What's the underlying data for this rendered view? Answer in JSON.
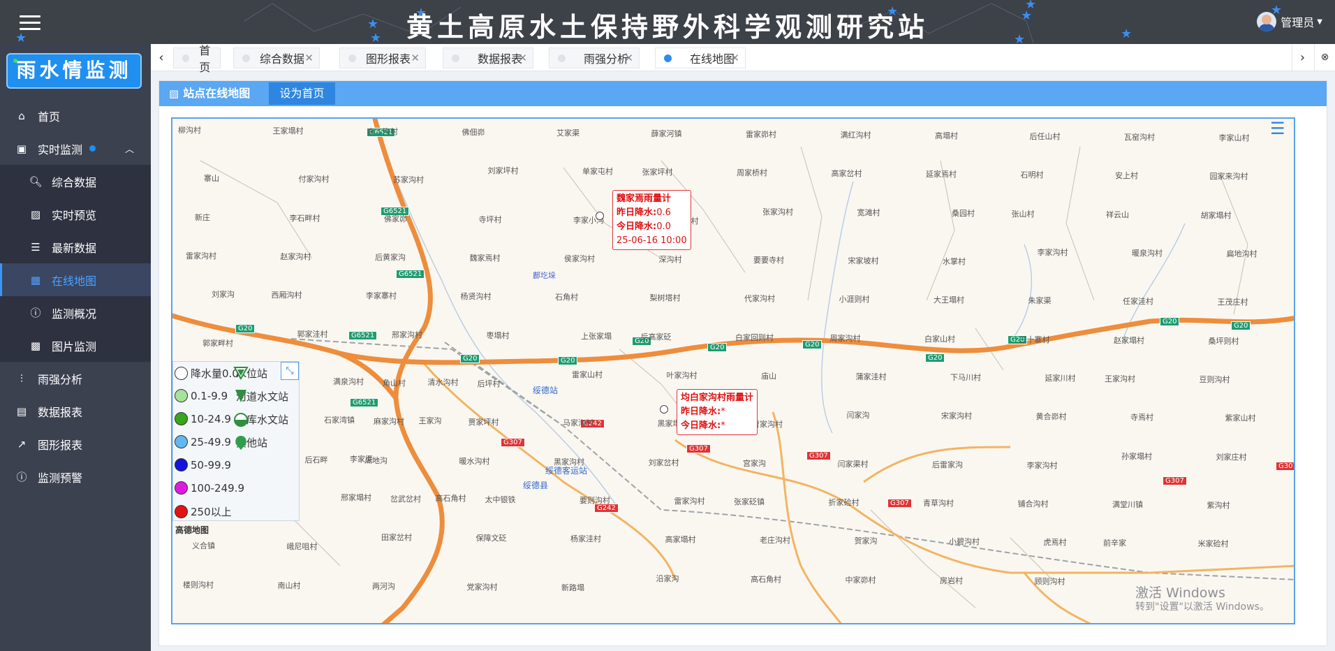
{
  "header": {
    "title": "黄土高原水土保持野外科学观测研究站",
    "user": "管理员"
  },
  "sidebar": {
    "logo": "雨水情监测",
    "items": [
      {
        "label": "首页",
        "icon": "home-icon"
      },
      {
        "label": "实时监测",
        "icon": "monitor-icon"
      },
      {
        "label": "综合数据",
        "icon": "search-doc-icon"
      },
      {
        "label": "实时预览",
        "icon": "image-icon"
      },
      {
        "label": "最新数据",
        "icon": "list-icon"
      },
      {
        "label": "在线地图",
        "icon": "map-icon"
      },
      {
        "label": "监测概况",
        "icon": "info-icon"
      },
      {
        "label": "图片监测",
        "icon": "picture-icon"
      },
      {
        "label": "雨强分析",
        "icon": "analysis-icon"
      },
      {
        "label": "数据报表",
        "icon": "report-icon"
      },
      {
        "label": "图形报表",
        "icon": "chart-icon"
      },
      {
        "label": "监测预警",
        "icon": "warning-icon"
      }
    ]
  },
  "tabs": [
    "首页",
    "综合数据",
    "图形报表",
    "数据报表",
    "雨强分析",
    "在线地图"
  ],
  "panel": {
    "title": "站点在线地图",
    "set_home": "设为首页"
  },
  "popups": [
    {
      "name": "魏家焉雨量计",
      "y_label": "昨日降水:",
      "y_val": "0.6",
      "t_label": "今日降水:",
      "t_val": "0.0",
      "time": "25-06-16 10:00"
    },
    {
      "name": "均白家沟村雨量计",
      "y_label": "昨日降水:",
      "y_val": "*",
      "t_label": "今日降水:",
      "t_val": "*"
    }
  ],
  "legend": {
    "rain": [
      {
        "label": "降水量0.0",
        "color": "#ffffff"
      },
      {
        "label": "0.1-9.9",
        "color": "#a6e39a"
      },
      {
        "label": "10-24.9",
        "color": "#38a51b"
      },
      {
        "label": "25-49.9",
        "color": "#5fb8ef"
      },
      {
        "label": "50-99.9",
        "color": "#1414dc"
      },
      {
        "label": "100-249.9",
        "color": "#e01be0"
      },
      {
        "label": "250以上",
        "color": "#e51212"
      }
    ],
    "stations": [
      "水位站",
      "河道水文站",
      "水库水文站",
      "其他站"
    ]
  },
  "map": {
    "provider": "高德地图",
    "places": [
      "柳沟村",
      "王家塌村",
      "高二沟村",
      "佛佃峁",
      "艾家渠",
      "薛家河镇",
      "雷家峁村",
      "满红沟村",
      "高塌村",
      "后任山村",
      "瓦窑沟村",
      "李家山村",
      "寨山",
      "付家沟村",
      "苏家沟村",
      "刘家坪村",
      "单家屯村",
      "张家坪村",
      "周家桥村",
      "高家岔村",
      "延家焉村",
      "石明村",
      "安上村",
      "园家来沟村",
      "新庄",
      "李石畔村",
      "佛家峁",
      "寺坪村",
      "李家小沟",
      "延家沟村",
      "张家沟村",
      "宽滩村",
      "桑园村",
      "张山村",
      "祥云山",
      "胡家塌村",
      "雷家沟村",
      "赵家沟村",
      "后黄家沟",
      "魏家焉村",
      "侯家沟村",
      "深沟村",
      "要要寺村",
      "宋家坡村",
      "水掌村",
      "李家沟村",
      "暖泉沟村",
      "扁地沟村",
      "刘家沟",
      "西厢沟村",
      "李家寨村",
      "杨贤沟村",
      "石角村",
      "梨树塔村",
      "代家沟村",
      "小涯则村",
      "大王塌村",
      "朱家渠",
      "任家洼村",
      "王茂庄村",
      "郭家畔村",
      "郭家洼村",
      "邢家沟村",
      "枣塌村",
      "上张家塌",
      "后高家砭",
      "白家回则村",
      "周家沟村",
      "白家山村",
      "三十寨村",
      "赵家塌村",
      "桑坪则村",
      "满泉沟村",
      "清水沟村",
      "角山村",
      "后坪村",
      "雷家山村",
      "叶家沟村",
      "庙山",
      "蒲家洼村",
      "下马川村",
      "延家川村",
      "王家沟村",
      "豆则沟村",
      "石家湾镇",
      "王家沟",
      "麻家沟村",
      "贾家坪村",
      "马家沟村",
      "黑家塌",
      "曹家沟村",
      "闫家沟",
      "宋家沟村",
      "黄合峁村",
      "寺焉村",
      "紫家山村",
      "李家渠",
      "后石畔",
      "瓜地沟",
      "暖水沟村",
      "黑家沟村",
      "刘家岔村",
      "宫家沟",
      "闫家渠村",
      "后雷家沟",
      "李家沟村",
      "孙家塌村",
      "刘家庄村",
      "邢家塌村",
      "高石角村",
      "岔武岔村",
      "太中银铁",
      "要则沟村",
      "雷家沟村",
      "张家砭镇",
      "折家硷村",
      "青草沟村",
      "铺合沟村",
      "满堂川镇",
      "紫沟村",
      "义合镇",
      "峨尼咀村",
      "田家岔村",
      "保障文砭",
      "杨家洼村",
      "高家塌村",
      "老庄沟村",
      "贺家沟",
      "小碧沟村",
      "虎焉村",
      "前辛家",
      "米家硷村",
      "楼则沟村",
      "南山村",
      "两河沟",
      "党家沟村",
      "新路塌",
      "沿家沟",
      "高石角村",
      "中家峁村",
      "房岩村",
      "顾则沟村"
    ]
  },
  "stations_map": {
    "suide_station": "绥德站",
    "suide_bus": "绥德客运站",
    "suide_county": "绥德县",
    "reservoir": "鄜圪垛"
  },
  "roads": [
    "G6521",
    "G6521",
    "G6521",
    "G6521",
    "G6521",
    "G20",
    "G20",
    "G20",
    "G20",
    "G20",
    "G20",
    "G20",
    "G20",
    "G20",
    "G20",
    "G242",
    "G242",
    "G307",
    "G307",
    "G307",
    "G307",
    "G307",
    "G307"
  ],
  "watermark": {
    "line1": "激活 Windows",
    "line2": "转到\"设置\"以激活 Windows。"
  }
}
